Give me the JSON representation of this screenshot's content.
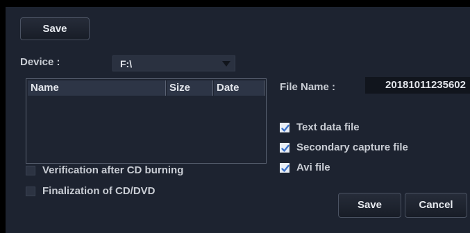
{
  "toolbar": {
    "save_label": "Save"
  },
  "device": {
    "label": "Device :",
    "value": "F:\\"
  },
  "file_list": {
    "columns": [
      "Name",
      "Size",
      "Date"
    ],
    "rows": []
  },
  "file_name": {
    "label": "File Name :",
    "value": "20181011235602"
  },
  "options": {
    "text_data_file": {
      "label": "Text data file",
      "checked": true
    },
    "secondary_capture_file": {
      "label": "Secondary capture file",
      "checked": true
    },
    "avi_file": {
      "label": "Avi file",
      "checked": true
    },
    "verification": {
      "label": "Verification after CD burning",
      "checked": false
    },
    "finalization": {
      "label": "Finalization of CD/DVD",
      "checked": false
    }
  },
  "footer": {
    "save_label": "Save",
    "cancel_label": "Cancel"
  }
}
